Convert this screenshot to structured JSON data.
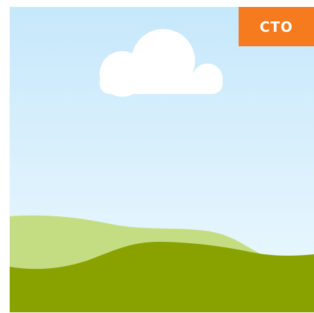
{
  "badge": {
    "label": "CTO",
    "color": "#f57b1e",
    "text_color": "#ffffff"
  },
  "scene": {
    "sky_top_color": "#c6e8fb",
    "sky_bottom_color": "#eef9fe",
    "cloud_color": "#ffffff",
    "back_hill_color": "#c4dd83",
    "front_hill_color": "#8aa200"
  }
}
